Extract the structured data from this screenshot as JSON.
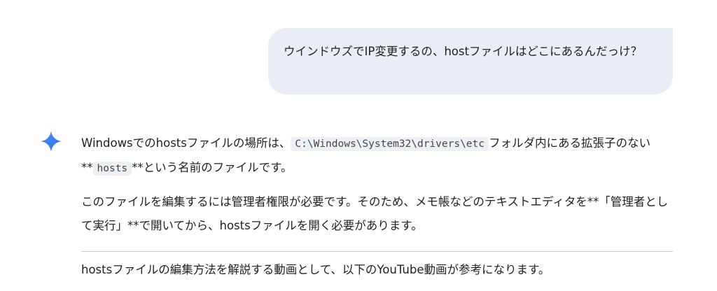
{
  "user_message": {
    "text": "ウインドウズでIP変更するの、hostファイルはどこにあるんだっけ？"
  },
  "assistant": {
    "icon": "gemini-sparkle-icon",
    "icon_color": "#4285f4",
    "p1_before_code": "Windowsでのhostsファイルの場所は、",
    "p1_code": "C:\\Windows\\System32\\drivers\\etc",
    "p1_mid": "フォルダ内にある拡張子のない**",
    "p1_code2": "hosts",
    "p1_after": "**という名前のファイルです。",
    "p2": "このファイルを編集するには管理者権限が必要です。そのため、メモ帳などのテキストエディタを**「管理者として実行」**で開いてから、hostsファイルを開く必要があります。",
    "p3": "hostsファイルの編集方法を解説する動画として、以下のYouTube動画が参考になります。"
  },
  "colors": {
    "bubble_bg": "#e9eef6",
    "code_bg": "#edf0f4",
    "text": "#1f1f1f",
    "divider": "#c8c8c8"
  }
}
